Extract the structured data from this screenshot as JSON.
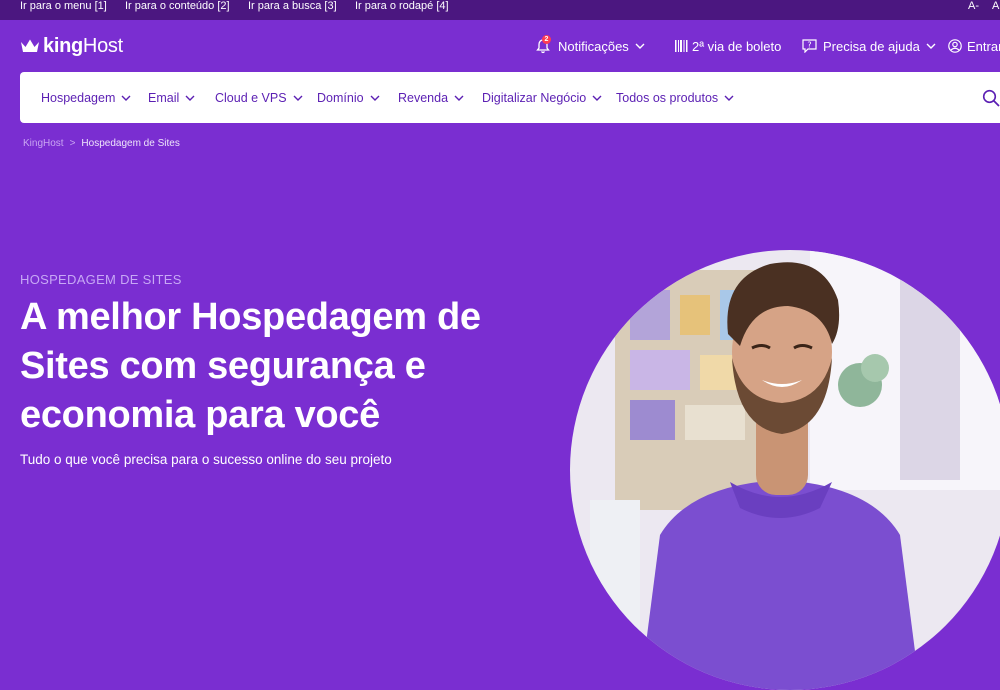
{
  "skip_links": [
    {
      "label": "Ir para o menu [1]"
    },
    {
      "label": "Ir para o conteúdo [2]"
    },
    {
      "label": "Ir para a busca [3]"
    },
    {
      "label": "Ir para o rodapé [4]"
    }
  ],
  "font_controls": {
    "decrease": "A-",
    "increase": "A"
  },
  "logo": {
    "part1": "king",
    "part2": "Host"
  },
  "header": {
    "notifications": {
      "label": "Notificações",
      "count": "2"
    },
    "boleto": {
      "label": "2ª via de boleto"
    },
    "help": {
      "label": "Precisa de ajuda"
    },
    "login": {
      "label": "Entrar"
    }
  },
  "nav": {
    "items": [
      {
        "label": "Hospedagem"
      },
      {
        "label": "Email"
      },
      {
        "label": "Cloud e VPS"
      },
      {
        "label": "Domínio"
      },
      {
        "label": "Revenda"
      },
      {
        "label": "Digitalizar Negócio"
      },
      {
        "label": "Todos os produtos"
      }
    ]
  },
  "breadcrumb": {
    "home": "KingHost",
    "separator": ">",
    "current": "Hospedagem de Sites"
  },
  "hero": {
    "eyebrow": "HOSPEDAGEM DE SITES",
    "title": "A melhor Hospedagem de Sites com segurança e economia para você",
    "subtitle": "Tudo o que você precisa para o sucesso online do seu projeto"
  },
  "colors": {
    "brand_purple": "#7a2ed1",
    "topbar_purple": "#4b1780",
    "nav_text": "#5b1fb3",
    "badge_red": "#ff3b52"
  }
}
